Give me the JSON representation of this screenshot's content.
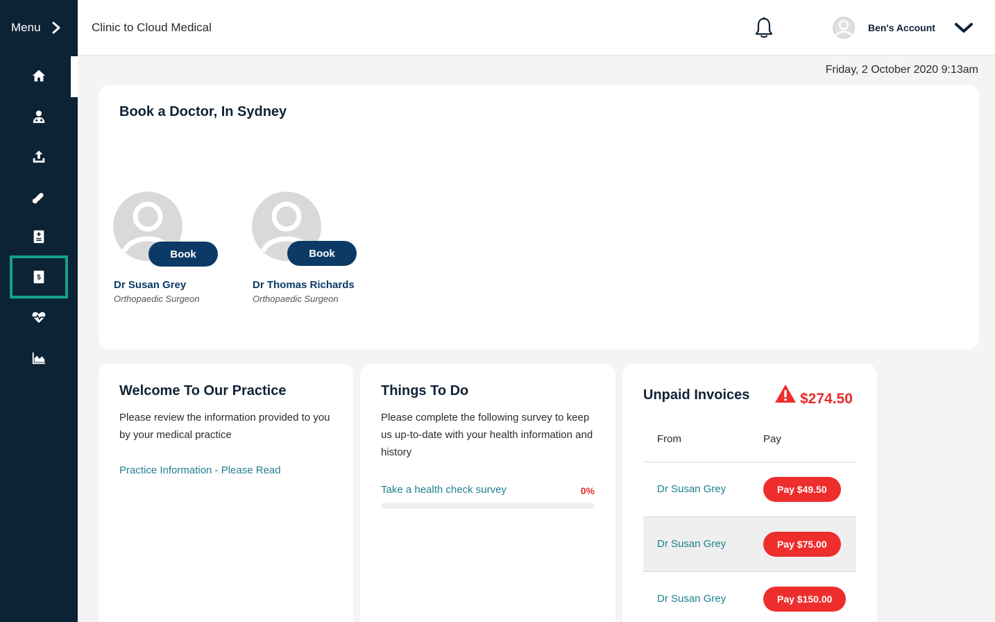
{
  "sidebar": {
    "menu_label": "Menu",
    "icons": [
      "home-icon",
      "doctor-icon",
      "upload-icon",
      "pills-icon",
      "medical-file-icon",
      "invoice-dollar-icon",
      "heart-pulse-icon",
      "area-chart-icon"
    ],
    "highlight_color": "#16a08f",
    "background_color": "#0c2235"
  },
  "header": {
    "title": "Clinic to Cloud Medical",
    "account_name": "Ben's Account"
  },
  "date_text": "Friday, 2 October 2020 9:13am",
  "book_doctor": {
    "title": "Book a Doctor, In Sydney",
    "doctors": [
      {
        "name": "Dr Susan Grey",
        "specialty": "Orthopaedic Surgeon",
        "book_label": "Book"
      },
      {
        "name": "Dr Thomas Richards",
        "specialty": "Orthopaedic Surgeon",
        "book_label": "Book"
      }
    ]
  },
  "welcome": {
    "title": "Welcome To Our Practice",
    "text": "Please review the information provided to you by your medical practice",
    "link": "Practice Information - Please Read"
  },
  "todo": {
    "title": "Things To Do",
    "text": "Please complete the following survey to keep us up-to-date with your health information and history",
    "survey_link": "Take a health check survey",
    "survey_progress_text": "0%",
    "survey_progress": 0
  },
  "invoices": {
    "title": "Unpaid Invoices",
    "total": "$274.50",
    "columns": [
      "From",
      "Pay"
    ],
    "rows": [
      {
        "from": "Dr Susan Grey",
        "pay_label": "Pay $49.50"
      },
      {
        "from": "Dr Susan Grey",
        "pay_label": "Pay $75.00"
      },
      {
        "from": "Dr Susan Grey",
        "pay_label": "Pay $150.00"
      }
    ],
    "accent_color": "#ee2d2d"
  }
}
